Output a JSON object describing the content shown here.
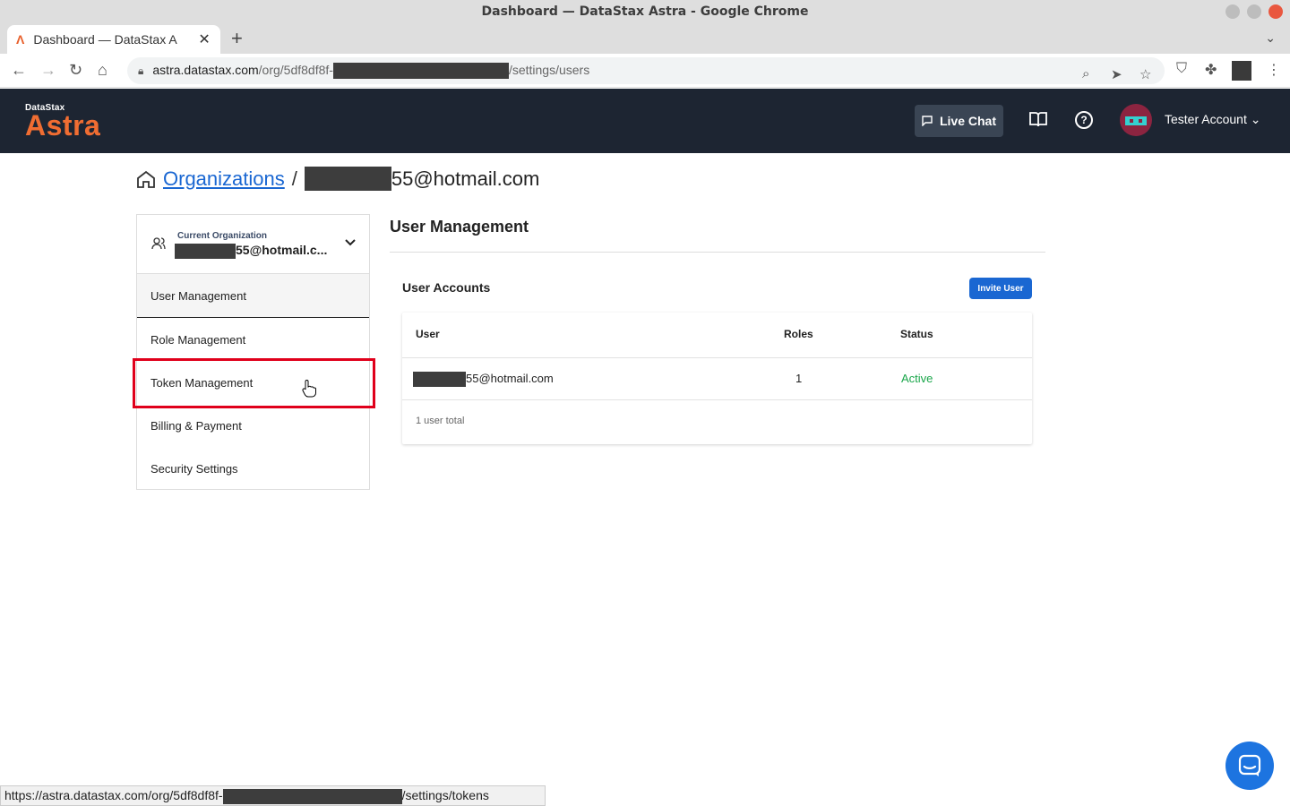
{
  "browser": {
    "window_title": "Dashboard — DataStax Astra - Google Chrome",
    "tab_title": "Dashboard — DataStax A",
    "url_host": "astra.datastax.com",
    "url_path_start": "/org/5df8df8f-",
    "url_path_end": "/settings/users",
    "status_url_start": "https://astra.datastax.com/org/5df8df8f-",
    "status_url_end": "/settings/tokens"
  },
  "header": {
    "logo_small": "DataStax",
    "logo_big": "Astra",
    "live_chat_label": "Live Chat",
    "account_label": "Tester Account"
  },
  "breadcrumb": {
    "organizations": "Organizations",
    "separator": "/",
    "current_suffix": "55@hotmail.com"
  },
  "sidebar": {
    "org_caption": "Current Organization",
    "org_name_suffix": "55@hotmail.c...",
    "items": [
      {
        "label": "User Management"
      },
      {
        "label": "Role Management"
      },
      {
        "label": "Token Management"
      },
      {
        "label": "Billing & Payment"
      },
      {
        "label": "Security Settings"
      }
    ]
  },
  "main": {
    "title": "User Management",
    "card_title": "User Accounts",
    "invite_label": "Invite User",
    "columns": [
      "User",
      "Roles",
      "Status"
    ],
    "rows": [
      {
        "user_suffix": "55@hotmail.com",
        "roles": "1",
        "status": "Active"
      }
    ],
    "total": "1 user total"
  },
  "colors": {
    "header_bg": "#1d2532",
    "accent": "#1a67d2",
    "brand": "#f06d32",
    "status_active": "#1aa64a",
    "highlight": "#e0001b"
  }
}
